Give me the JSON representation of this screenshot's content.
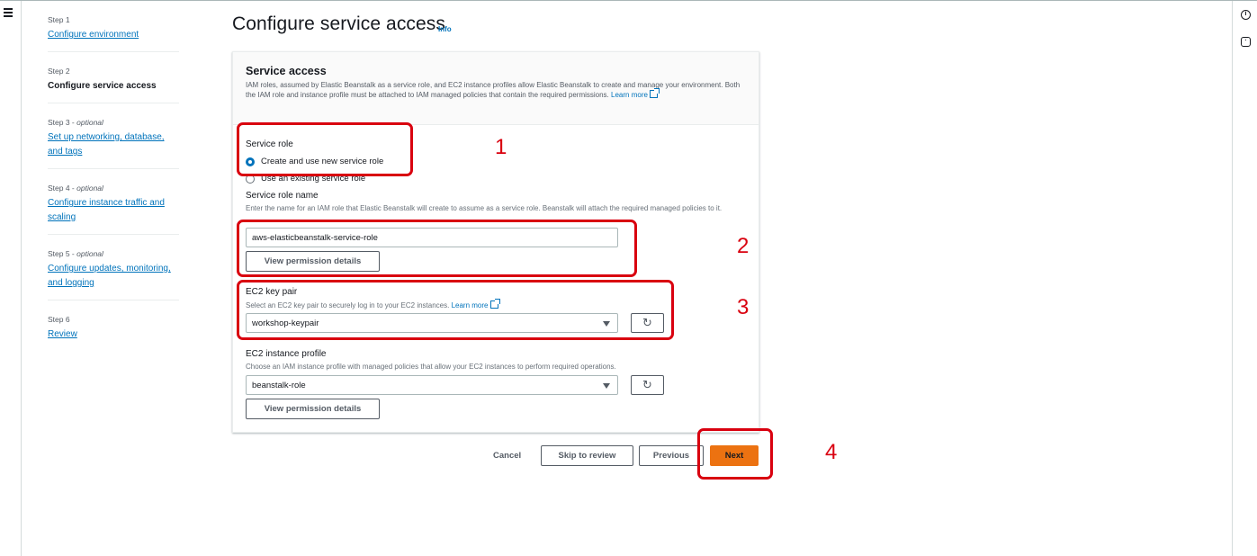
{
  "nav": {
    "menu_icon": "hamburger-menu-icon",
    "info_icon": "info-circle-icon",
    "settings_icon": "gear-icon"
  },
  "steps": [
    {
      "label": "Step 1",
      "title": "Configure environment",
      "current": false,
      "optional": ""
    },
    {
      "label": "Step 2",
      "title": "Configure service access",
      "current": true,
      "optional": ""
    },
    {
      "label": "Step 3 - ",
      "optional": "optional",
      "title": "Set up networking, database, and tags",
      "current": false
    },
    {
      "label": "Step 4 - ",
      "optional": "optional",
      "title": "Configure instance traffic and scaling",
      "current": false
    },
    {
      "label": "Step 5 - ",
      "optional": "optional",
      "title": "Configure updates, monitoring, and logging",
      "current": false
    },
    {
      "label": "Step 6",
      "title": "Review",
      "current": false,
      "optional": ""
    }
  ],
  "page": {
    "title": "Configure service access",
    "info": "Info"
  },
  "panel": {
    "title": "Service access",
    "description": "IAM roles, assumed by Elastic Beanstalk as a service role, and EC2 instance profiles allow Elastic Beanstalk to create and manage your environment. Both the IAM role and instance profile must be attached to IAM managed policies that contain the required permissions.",
    "learn_more": "Learn more",
    "service_role": {
      "label": "Service role",
      "option_new": "Create and use new service role",
      "option_existing": "Use an existing service role",
      "selected": "Create and use new service role"
    },
    "service_role_name": {
      "label": "Service role name",
      "description": "Enter the name for an IAM role that Elastic Beanstalk will create to assume as a service role. Beanstalk will attach the required managed policies to it.",
      "value": "aws-elasticbeanstalk-service-role",
      "button": "View permission details"
    },
    "key_pair": {
      "label": "EC2 key pair",
      "description": "Select an EC2 key pair to securely log in to your EC2 instances.",
      "learn_more": "Learn more",
      "value": "workshop-keypair"
    },
    "instance_profile": {
      "label": "EC2 instance profile",
      "description": "Choose an IAM instance profile with managed policies that allow your EC2 instances to perform required operations.",
      "value": "beanstalk-role",
      "button": "View permission details"
    }
  },
  "footer": {
    "cancel": "Cancel",
    "skip": "Skip to review",
    "previous": "Previous",
    "next": "Next"
  },
  "annotations": [
    "1",
    "2",
    "3",
    "4"
  ],
  "colors": {
    "accent": "#0073bb",
    "primary_button": "#ec7211",
    "annotation": "#d9000f"
  }
}
